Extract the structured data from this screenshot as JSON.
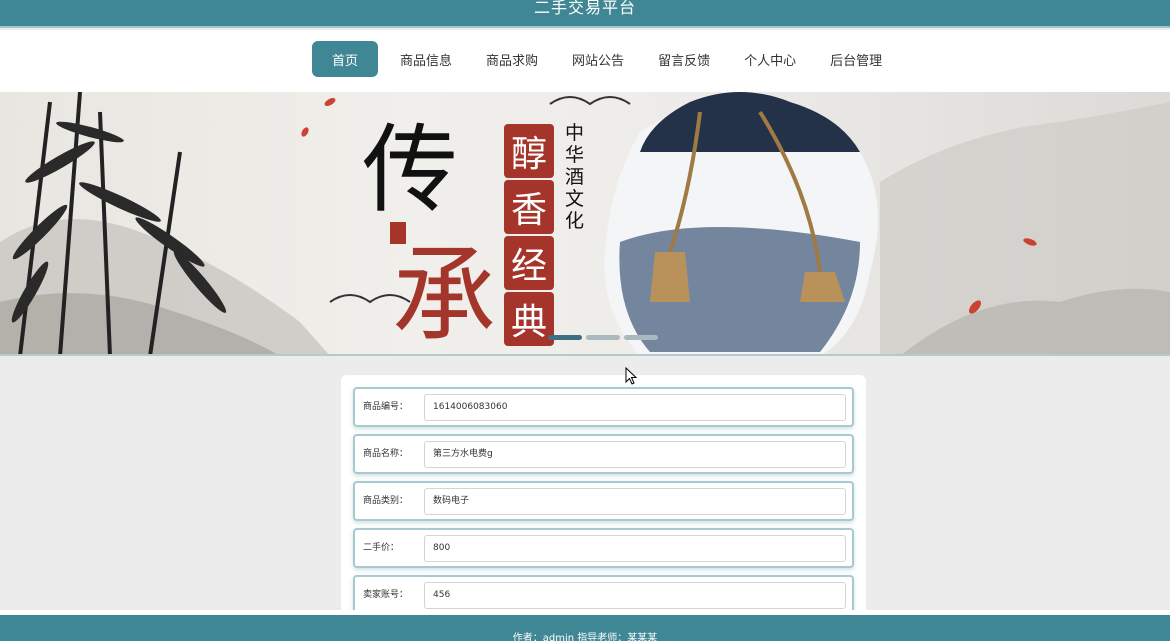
{
  "header": {
    "site_title": "二手交易平台"
  },
  "nav": {
    "items": [
      {
        "label": "首页"
      },
      {
        "label": "商品信息"
      },
      {
        "label": "商品求购"
      },
      {
        "label": "网站公告"
      },
      {
        "label": "留言反馈"
      },
      {
        "label": "个人中心"
      },
      {
        "label": "后台管理"
      }
    ],
    "active_index": 0
  },
  "banner": {
    "big_char_1": "传",
    "big_char_2": "承",
    "seal_chars": [
      "醇",
      "香",
      "经",
      "典"
    ],
    "vertical_text": "中华酒文化",
    "slide_count": 3,
    "active_slide": 0
  },
  "form": {
    "fields": [
      {
        "label": "商品编号：",
        "value": "1614006083060"
      },
      {
        "label": "商品名称：",
        "value": "第三方水电费g"
      },
      {
        "label": "商品类别：",
        "value": "数码电子"
      },
      {
        "label": "二手价：",
        "value": "800"
      },
      {
        "label": "卖家账号：",
        "value": "456"
      }
    ]
  },
  "footer": {
    "text": "作者：admin 指导老师：某某某"
  },
  "colors": {
    "primary": "#3f8795",
    "seal_red": "#a5342a",
    "background": "#ececec"
  }
}
